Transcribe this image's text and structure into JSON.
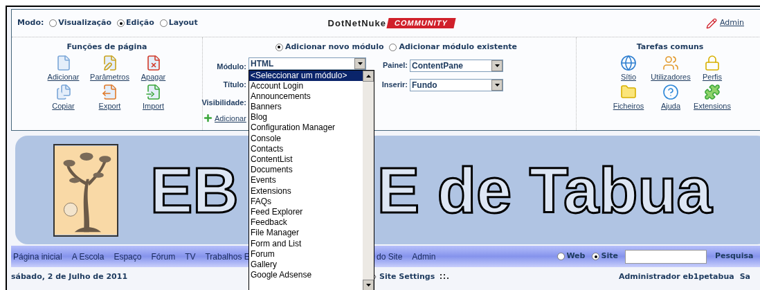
{
  "mode": {
    "label": "Modo:",
    "options": [
      {
        "label": "Visualização",
        "selected": false
      },
      {
        "label": "Edição",
        "selected": true
      },
      {
        "label": "Layout",
        "selected": false
      }
    ]
  },
  "brand": {
    "name": "DotNetNuke",
    "badge": "COMMUNITY"
  },
  "user_link": "Admin",
  "page_functions": {
    "title": "Funções de página",
    "items": [
      {
        "label": "Adicionar",
        "kind": "add"
      },
      {
        "label": "Parâmetros",
        "kind": "edit"
      },
      {
        "label": "Apagar",
        "kind": "delete"
      },
      {
        "label": "Copiar",
        "kind": "copy"
      },
      {
        "label": "Export",
        "kind": "export"
      },
      {
        "label": "Import",
        "kind": "import"
      }
    ]
  },
  "add_module": {
    "sources": [
      {
        "label": "Adicionar novo módulo",
        "selected": true
      },
      {
        "label": "Adicionar módulo existente",
        "selected": false
      }
    ],
    "module_label": "Módulo:",
    "module_value": "HTML",
    "title_label": "Título:",
    "visibility_label": "Visibilidade:",
    "add_link": "Adicionar",
    "pane_label": "Painel:",
    "pane_value": "ContentPane",
    "insert_label": "Inserir:",
    "insert_value": "Fundo",
    "dropdown": [
      {
        "label": "<Seleccionar um módulo>",
        "selected": true
      },
      {
        "label": "Account Login",
        "selected": false
      },
      {
        "label": "Announcements",
        "selected": false
      },
      {
        "label": "Banners",
        "selected": false
      },
      {
        "label": "Blog",
        "selected": false
      },
      {
        "label": "Configuration Manager",
        "selected": false
      },
      {
        "label": "Console",
        "selected": false
      },
      {
        "label": "Contacts",
        "selected": false
      },
      {
        "label": "ContentList",
        "selected": false
      },
      {
        "label": "Documents",
        "selected": false
      },
      {
        "label": "Events",
        "selected": false
      },
      {
        "label": "Extensions",
        "selected": false
      },
      {
        "label": "FAQs",
        "selected": false
      },
      {
        "label": "Feed Explorer",
        "selected": false
      },
      {
        "label": "Feedback",
        "selected": false
      },
      {
        "label": "File Manager",
        "selected": false
      },
      {
        "label": "Form and List",
        "selected": false
      },
      {
        "label": "Forum",
        "selected": false
      },
      {
        "label": "Gallery",
        "selected": false
      },
      {
        "label": "Google Adsense",
        "selected": false
      }
    ]
  },
  "common_tasks": {
    "title": "Tarefas comuns",
    "items": [
      {
        "label": "Sítio",
        "kind": "site"
      },
      {
        "label": "Utilizadores",
        "kind": "users"
      },
      {
        "label": "Perfis",
        "kind": "roles"
      },
      {
        "label": "Ficheiros",
        "kind": "files"
      },
      {
        "label": "Ajuda",
        "kind": "help"
      },
      {
        "label": "Extensions",
        "kind": "extensions"
      }
    ]
  },
  "banner": {
    "text_left": "EB",
    "text_right": "E de Tabua"
  },
  "nav": {
    "items_left": [
      "Página inicial",
      "A Escola",
      "Espaço",
      "Fórum",
      "TV",
      "Trabalhos E"
    ],
    "items_right": [
      "do Site",
      "Admin"
    ],
    "search_scope": [
      {
        "label": "Web",
        "selected": false
      },
      {
        "label": "Site",
        "selected": true
      }
    ],
    "search_button": "Pesquisa"
  },
  "info_bar": {
    "date": "sábado, 2 de Julho de 2011",
    "page": "Site Settings",
    "user": "Administrador eb1petabua",
    "logout": "Sa"
  }
}
